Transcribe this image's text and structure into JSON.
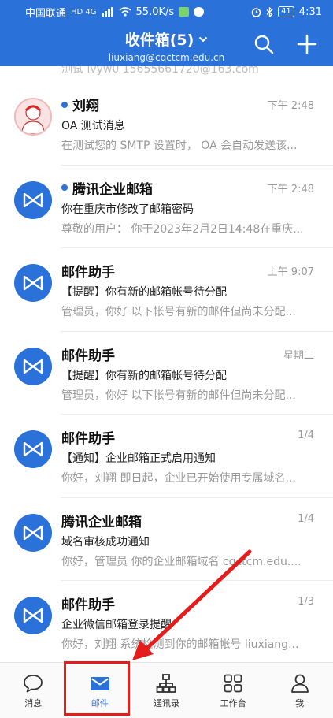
{
  "status_bar": {
    "carrier": "中国联通",
    "network_mini": "HD 4G",
    "speed": "55.0K/s",
    "battery": "41",
    "time": "4:31"
  },
  "header": {
    "title": "收件箱(5)",
    "account": "liuxiang@cqctcm.edu.cn",
    "bg_color": "#2a72d9"
  },
  "list": {
    "peek_text": "测试 lvyw0 15655661720@163.com",
    "mails": [
      {
        "sender": "刘翔",
        "unread": true,
        "time": "下午 2:48",
        "subject": "OA 测试消息",
        "preview": "在测试您的 SMTP 设置时， OA 会自动发送该...",
        "avatar": "photo"
      },
      {
        "sender": "腾讯企业邮箱",
        "unread": true,
        "time": "下午 2:48",
        "subject": "你在重庆市修改了邮箱密码",
        "preview": "尊敬的用户： 你于2023年2月2日14:48在重庆...",
        "avatar": "logo"
      },
      {
        "sender": "邮件助手",
        "unread": false,
        "time": "上午 9:07",
        "subject": "【提醒】你有新的邮箱帐号待分配",
        "preview": "管理员，你好 以下帐号有新的邮件但尚未分配...",
        "avatar": "logo"
      },
      {
        "sender": "邮件助手",
        "unread": false,
        "time": "星期二",
        "subject": "【提醒】你有新的邮箱帐号待分配",
        "preview": "管理员，你好 以下帐号有新的邮件但尚未分配...",
        "avatar": "logo"
      },
      {
        "sender": "邮件助手",
        "unread": false,
        "time": "1/4",
        "subject": "【通知】企业邮箱正式启用通知",
        "preview": "你好，刘翔 即日起，企业已开始使用专属域名...",
        "avatar": "logo"
      },
      {
        "sender": "腾讯企业邮箱",
        "unread": false,
        "time": "1/4",
        "subject": "域名审核成功通知",
        "preview": "你好，管理员 你的企业邮箱域名 cqctcm.edu....",
        "avatar": "logo"
      },
      {
        "sender": "邮件助手",
        "unread": false,
        "time": "1/3",
        "subject": "企业微信邮箱登录提醒",
        "preview": "你好，刘翔 系统检测到你的邮箱帐号 liuxiang...",
        "avatar": "logo"
      }
    ]
  },
  "tabs": [
    {
      "label": "消息",
      "icon": "chat-bubble-icon",
      "active": false
    },
    {
      "label": "邮件",
      "icon": "envelope-icon",
      "active": true
    },
    {
      "label": "通讯录",
      "icon": "org-chart-icon",
      "active": false
    },
    {
      "label": "工作台",
      "icon": "grid-icon",
      "active": false
    },
    {
      "label": "我",
      "icon": "person-icon",
      "active": false
    }
  ],
  "annotation": {
    "color": "#e51c1c"
  }
}
